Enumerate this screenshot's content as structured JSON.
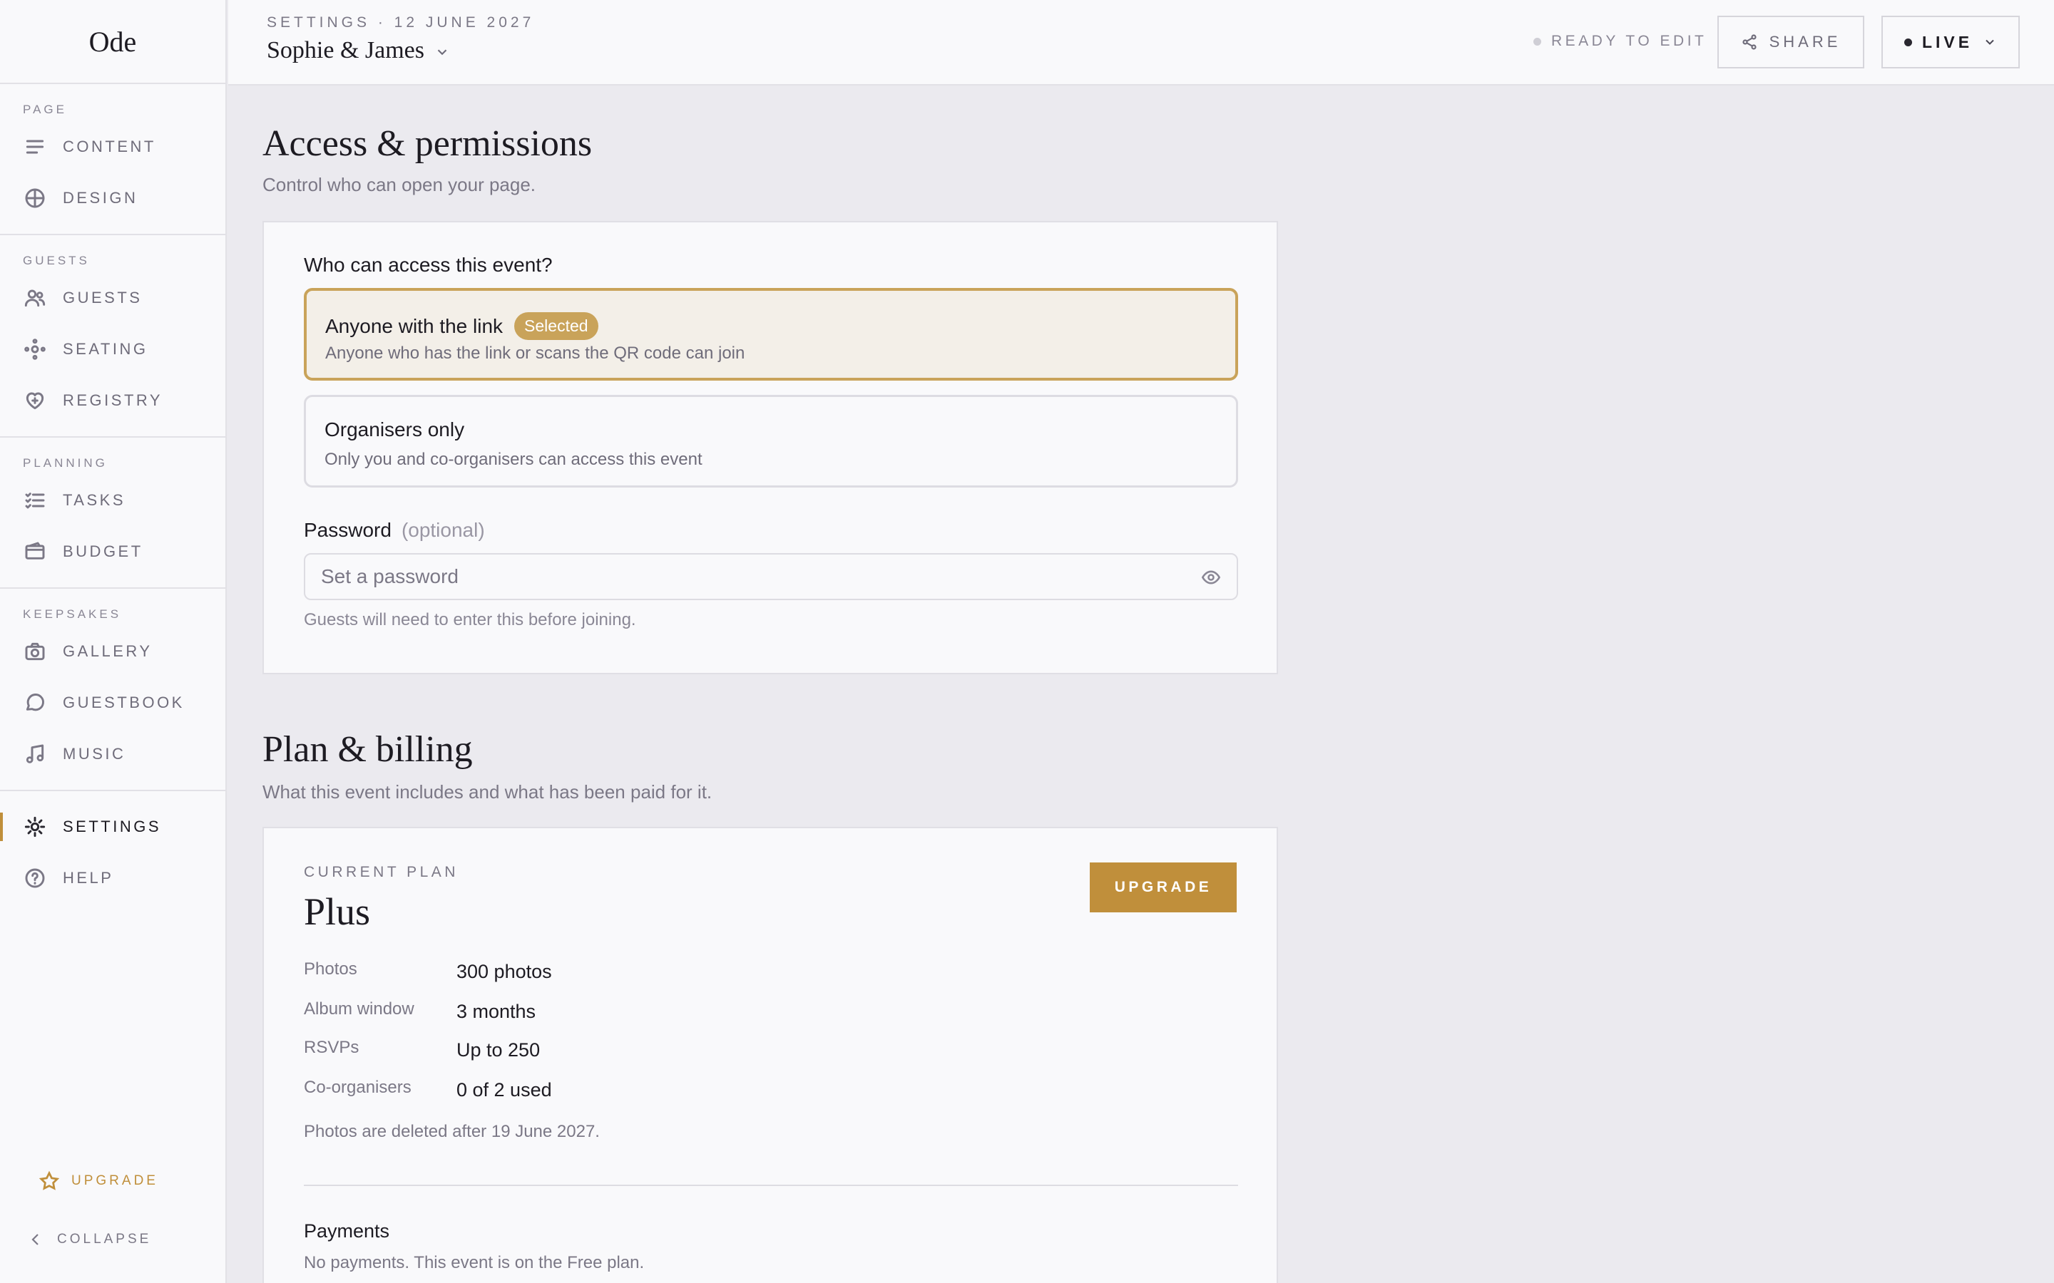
{
  "app": {
    "logo": "Ode"
  },
  "sidebar": {
    "sections": [
      {
        "label": "PAGE",
        "items": [
          {
            "label": "CONTENT",
            "icon": "lines-icon"
          },
          {
            "label": "DESIGN",
            "icon": "globe-icon"
          }
        ]
      },
      {
        "label": "GUESTS",
        "items": [
          {
            "label": "GUESTS",
            "icon": "people-icon"
          },
          {
            "label": "SEATING",
            "icon": "seating-icon"
          },
          {
            "label": "REGISTRY",
            "icon": "heart-plus-icon"
          }
        ]
      },
      {
        "label": "PLANNING",
        "items": [
          {
            "label": "TASKS",
            "icon": "checklist-icon"
          },
          {
            "label": "BUDGET",
            "icon": "wallet-icon"
          }
        ]
      },
      {
        "label": "KEEPSAKES",
        "items": [
          {
            "label": "GALLERY",
            "icon": "camera-icon"
          },
          {
            "label": "GUESTBOOK",
            "icon": "chat-icon"
          },
          {
            "label": "MUSIC",
            "icon": "music-icon"
          }
        ]
      }
    ],
    "settings": {
      "label": "SETTINGS",
      "icon": "gear-icon",
      "active": true
    },
    "help": {
      "label": "HELP",
      "icon": "help-icon"
    },
    "upgrade": "UPGRADE",
    "collapse": "COLLAPSE"
  },
  "header": {
    "breadcrumb": "SETTINGS · 12 JUNE 2027",
    "event_name": "Sophie & James",
    "status": "READY TO EDIT",
    "share": "SHARE",
    "live": "LIVE"
  },
  "access": {
    "title": "Access & permissions",
    "subtitle": "Control who can open your page.",
    "question": "Who can access this event?",
    "options": [
      {
        "title": "Anyone with the link",
        "badge": "Selected",
        "desc": "Anyone who has the link or scans the QR code can join",
        "selected": true
      },
      {
        "title": "Organisers only",
        "desc": "Only you and co-organisers can access this event",
        "selected": false
      }
    ],
    "password_label": "Password",
    "password_optional": "(optional)",
    "password_placeholder": "Set a password",
    "password_value": "",
    "password_hint": "Guests will need to enter this before joining."
  },
  "plan": {
    "title": "Plan & billing",
    "subtitle": "What this event includes and what has been paid for it.",
    "current_label": "CURRENT PLAN",
    "name": "Plus",
    "upgrade": "UPGRADE",
    "features": [
      {
        "key": "Photos",
        "value": "300 photos"
      },
      {
        "key": "Album window",
        "value": "3 months"
      },
      {
        "key": "RSVPs",
        "value": "Up to 250"
      },
      {
        "key": "Co-organisers",
        "value": "0 of 2 used"
      }
    ],
    "note": "Photos are deleted after 19 June 2027.",
    "payments_title": "Payments",
    "payments_desc": "No payments. This event is on the Free plan."
  },
  "colors": {
    "accent": "#c08f3b",
    "selected_border": "#c9a35a",
    "selected_bg": "#f3efe8",
    "page_bg": "#ebeaef"
  }
}
